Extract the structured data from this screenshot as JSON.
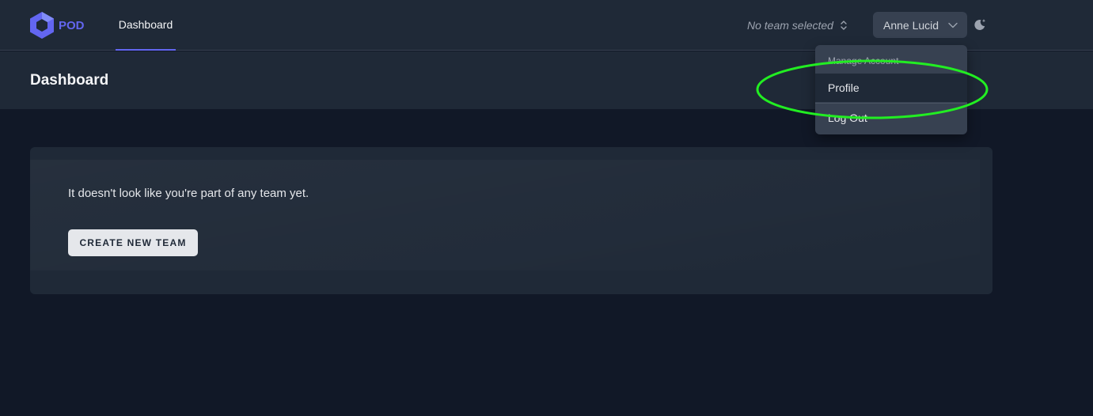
{
  "brand": {
    "name": "POD",
    "logo_icon": "hexagon-cube-icon",
    "color": "#6366f1"
  },
  "nav": {
    "links": [
      {
        "label": "Dashboard",
        "active": true
      }
    ]
  },
  "team_switcher": {
    "label": "No team selected",
    "icon": "chevron-up-down-icon"
  },
  "user_menu": {
    "name": "Anne Lucid",
    "icon": "chevron-down-icon",
    "dropdown": {
      "heading": "Manage Account",
      "items": [
        {
          "label": "Profile",
          "highlighted": true
        },
        {
          "label": "Log Out"
        }
      ]
    }
  },
  "theme_toggle": {
    "icon": "moon-star-icon"
  },
  "header": {
    "title": "Dashboard"
  },
  "main": {
    "empty_state": {
      "message": "It doesn't look like you're part of any team yet.",
      "button_label": "CREATE NEW TEAM"
    }
  },
  "annotation": {
    "color": "#22ee22",
    "target": "Profile"
  }
}
